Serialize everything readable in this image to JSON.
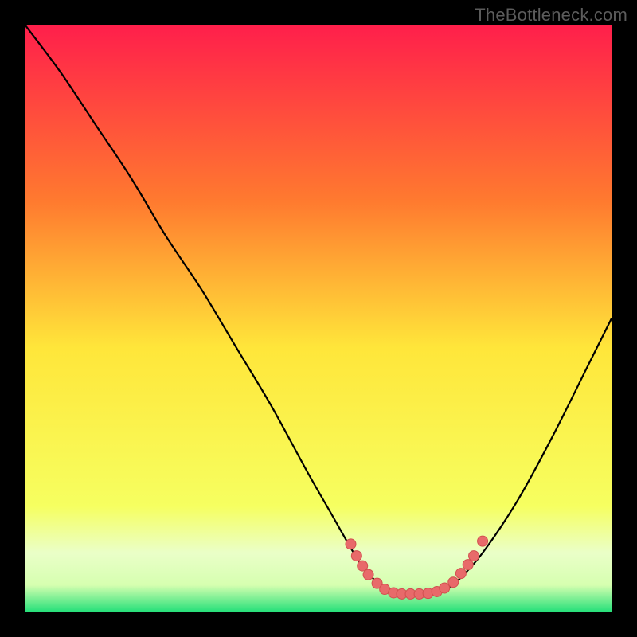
{
  "watermark": "TheBottleneck.com",
  "colors": {
    "page_bg": "#000000",
    "curve": "#000000",
    "marker_fill": "#e86a6a",
    "marker_stroke": "#d24f4f",
    "gradient_top": "#ff1f4b",
    "gradient_mid_upper": "#ff9a2a",
    "gradient_mid": "#ffe63a",
    "gradient_lower_yellow": "#f6ff60",
    "gradient_pale": "#eaffc8",
    "gradient_bottom": "#27e07a"
  },
  "chart_data": {
    "type": "line",
    "title": "",
    "xlabel": "",
    "ylabel": "",
    "xlim": [
      0,
      100
    ],
    "ylim": [
      0,
      100
    ],
    "gradient_stops": [
      {
        "offset": 0.0,
        "color": "#ff1f4b"
      },
      {
        "offset": 0.3,
        "color": "#ff7a2f"
      },
      {
        "offset": 0.55,
        "color": "#ffe63a"
      },
      {
        "offset": 0.82,
        "color": "#f6ff60"
      },
      {
        "offset": 0.9,
        "color": "#eaffc8"
      },
      {
        "offset": 0.955,
        "color": "#d6ffb0"
      },
      {
        "offset": 1.0,
        "color": "#27e07a"
      }
    ],
    "series": [
      {
        "name": "bottleneck-curve",
        "x": [
          0,
          6,
          12,
          18,
          24,
          30,
          36,
          42,
          48,
          52,
          56,
          58,
          60,
          62,
          64,
          66,
          68,
          70,
          72,
          74,
          78,
          84,
          90,
          96,
          100
        ],
        "y": [
          100,
          92,
          83,
          74,
          64,
          55,
          45,
          35,
          24,
          17,
          10,
          7,
          5,
          3.5,
          3,
          3,
          3,
          3.2,
          4,
          5.5,
          10,
          19,
          30,
          42,
          50
        ]
      }
    ],
    "markers": [
      {
        "x": 55.5,
        "y": 11.5
      },
      {
        "x": 56.5,
        "y": 9.5
      },
      {
        "x": 57.5,
        "y": 7.8
      },
      {
        "x": 58.5,
        "y": 6.3
      },
      {
        "x": 60.0,
        "y": 4.8
      },
      {
        "x": 61.3,
        "y": 3.8
      },
      {
        "x": 62.8,
        "y": 3.2
      },
      {
        "x": 64.2,
        "y": 3.0
      },
      {
        "x": 65.7,
        "y": 3.0
      },
      {
        "x": 67.2,
        "y": 3.0
      },
      {
        "x": 68.7,
        "y": 3.1
      },
      {
        "x": 70.2,
        "y": 3.4
      },
      {
        "x": 71.5,
        "y": 4.0
      },
      {
        "x": 73.0,
        "y": 5.0
      },
      {
        "x": 74.3,
        "y": 6.5
      },
      {
        "x": 75.5,
        "y": 8.0
      },
      {
        "x": 76.5,
        "y": 9.5
      },
      {
        "x": 78.0,
        "y": 12.0
      }
    ]
  }
}
